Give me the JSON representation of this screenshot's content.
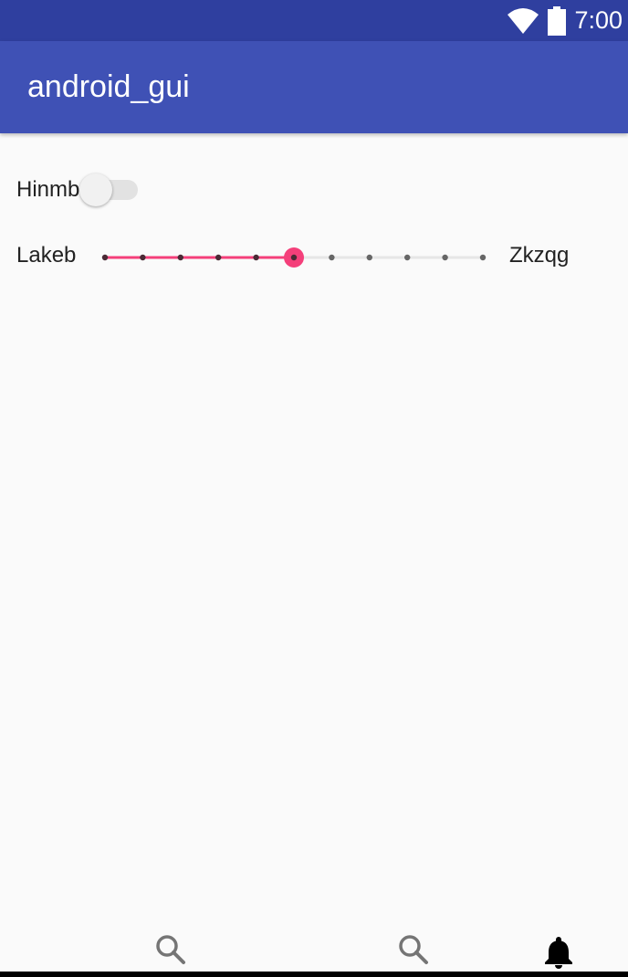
{
  "status_bar": {
    "time": "7:00",
    "icons": [
      "wifi-icon",
      "battery-icon"
    ],
    "color": "#2f3f9f"
  },
  "app_bar": {
    "title": "android_gui",
    "color": "#3f51b5"
  },
  "switch": {
    "label": "Hinmb",
    "checked": false
  },
  "slider": {
    "min_label": "Lakeb",
    "max_label": "Zkzqg",
    "steps": 10,
    "value": 5,
    "accent_color": "#f43f7a"
  },
  "bottom_nav": {
    "items": [
      {
        "icon": "search-icon",
        "active": false
      },
      {
        "icon": "search-icon",
        "active": false
      },
      {
        "icon": "bell-icon",
        "active": true
      }
    ]
  }
}
